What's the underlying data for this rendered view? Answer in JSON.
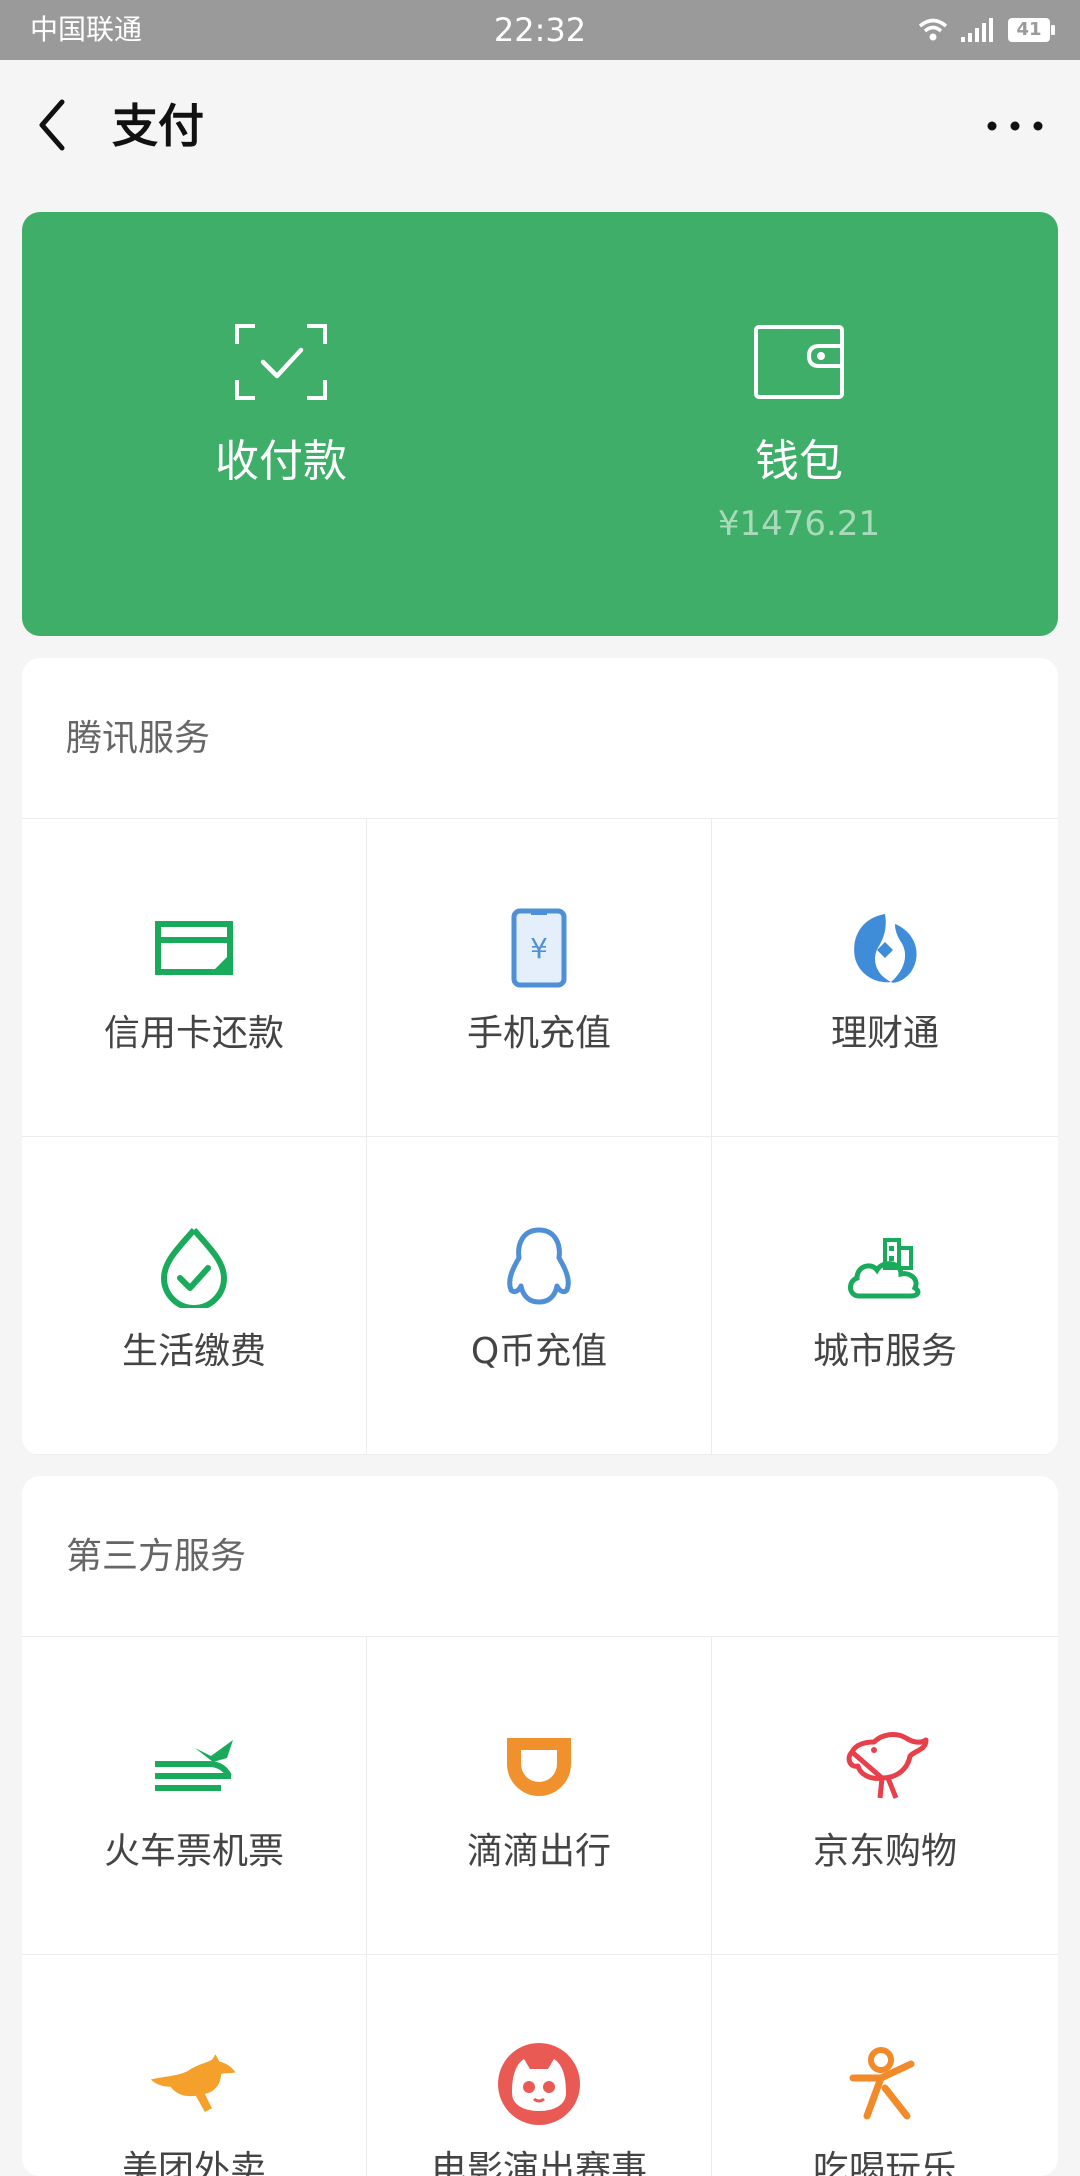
{
  "status_bar": {
    "carrier": "中国联通",
    "time": "22:32",
    "battery": "41"
  },
  "nav": {
    "title": "支付",
    "back_icon": "chevron-left",
    "more_icon": "ellipsis"
  },
  "card": {
    "color": "#3eae69",
    "receive_label": "收付款",
    "wallet_label": "钱包",
    "wallet_balance": "¥1476.21"
  },
  "tencent": {
    "title": "腾讯服务",
    "items": [
      {
        "label": "信用卡还款",
        "icon": "credit-card-icon",
        "color": "#1aaa5c"
      },
      {
        "label": "手机充值",
        "icon": "mobile-recharge-icon",
        "color": "#4f8fd6"
      },
      {
        "label": "理财通",
        "icon": "wealth-icon",
        "color": "#3f8cd8"
      },
      {
        "label": "生活缴费",
        "icon": "utility-payment-icon",
        "color": "#1aaa5c"
      },
      {
        "label": "Q币充值",
        "icon": "qq-penguin-icon",
        "color": "#4f8fd6"
      },
      {
        "label": "城市服务",
        "icon": "city-service-icon",
        "color": "#1aaa5c"
      }
    ]
  },
  "third_party": {
    "title": "第三方服务",
    "items": [
      {
        "label": "火车票机票",
        "icon": "train-plane-icon",
        "color": "#1aaa5c"
      },
      {
        "label": "滴滴出行",
        "icon": "didi-icon",
        "color": "#f0912e"
      },
      {
        "label": "京东购物",
        "icon": "jd-dog-icon",
        "color": "#e8404a"
      },
      {
        "label": "美团外卖",
        "icon": "kangaroo-icon",
        "color": "#f5a02a"
      },
      {
        "label": "电影演出赛事",
        "icon": "cat-eye-icon",
        "color": "#ea5a55"
      },
      {
        "label": "吃喝玩乐",
        "icon": "dianping-icon",
        "color": "#f28a2a"
      }
    ]
  }
}
